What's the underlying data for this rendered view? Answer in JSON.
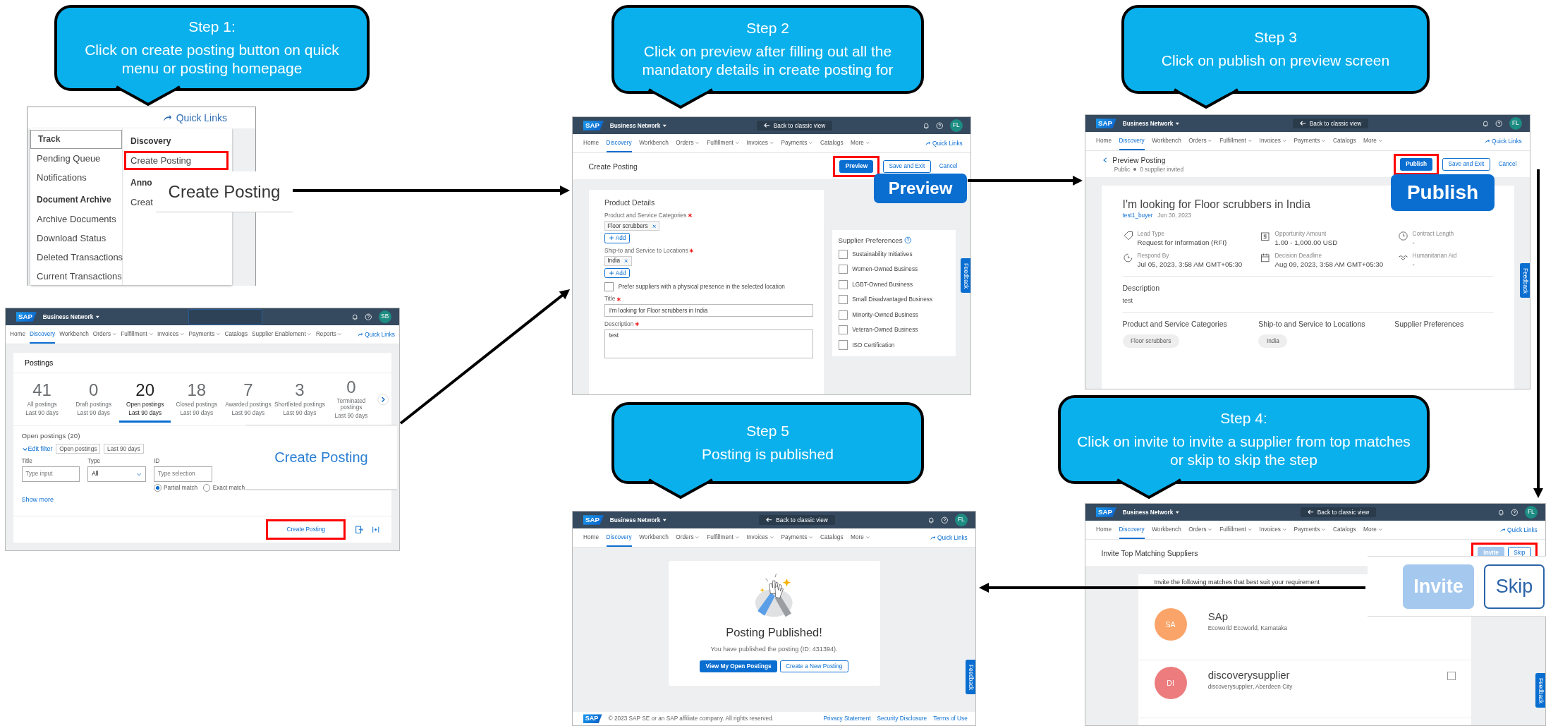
{
  "callouts": [
    {
      "title": "Step 1:",
      "text": "Click on create posting button on quick menu or posting homepage"
    },
    {
      "title": "Step 2",
      "text": "Click on preview  after filling out all the mandatory details in create posting for"
    },
    {
      "title": "Step 3",
      "text": "Click on publish on preview screen"
    },
    {
      "title": "Step 5",
      "text": "Posting is published"
    },
    {
      "title": "Step 4:",
      "text": "Click on invite to invite a supplier from top matches or skip to skip the step"
    }
  ],
  "menu": {
    "quick_links": "Quick Links",
    "zoom": "Create Posting",
    "columns": [
      {
        "items": [
          {
            "kind": "tab",
            "label": "Track",
            "highlighted": false
          },
          {
            "kind": "link",
            "label": "Pending Queue",
            "highlighted": false
          },
          {
            "kind": "link",
            "label": "Notifications",
            "highlighted": false
          },
          {
            "kind": "heading",
            "label": "Document Archive",
            "highlighted": false
          },
          {
            "kind": "link",
            "label": "Archive Documents",
            "highlighted": false
          },
          {
            "kind": "link",
            "label": "Download Status",
            "highlighted": false
          },
          {
            "kind": "link",
            "label": "Deleted Transactions",
            "highlighted": false
          },
          {
            "kind": "link",
            "label": "Current Transactions",
            "highlighted": false
          }
        ]
      },
      {
        "items": [
          {
            "kind": "heading",
            "label": "Discovery",
            "highlighted": false
          },
          {
            "kind": "link",
            "label": "Create Posting",
            "highlighted": true
          },
          {
            "kind": "heading",
            "label": "Anno",
            "highlighted": false
          },
          {
            "kind": "link",
            "label": "Creat",
            "highlighted": false
          }
        ]
      }
    ]
  },
  "screens": [
    {
      "kind": "postings",
      "header": {
        "logo": "SAP",
        "product": "Business Network",
        "avatar": "SB",
        "quick_links": "Quick Links",
        "nav": [
          {
            "label": "Home",
            "selected": false,
            "menu": false
          },
          {
            "label": "Discovery",
            "selected": true,
            "menu": false
          },
          {
            "label": "Workbench",
            "selected": false,
            "menu": false
          },
          {
            "label": "Orders",
            "selected": false,
            "menu": true
          },
          {
            "label": "Fulfillment",
            "selected": false,
            "menu": true
          },
          {
            "label": "Invoices",
            "selected": false,
            "menu": true
          },
          {
            "label": "Payments",
            "selected": false,
            "menu": true
          },
          {
            "label": "Catalogs",
            "selected": false,
            "menu": false
          },
          {
            "label": "Supplier Enablement",
            "selected": false,
            "menu": true
          },
          {
            "label": "Reports",
            "selected": false,
            "menu": true
          }
        ]
      },
      "title": "Postings",
      "tiles": [
        {
          "count": "41",
          "label": "All postings",
          "period": "Last 90 days",
          "selected": false
        },
        {
          "count": "0",
          "label": "Draft postings",
          "period": "Last 90 days",
          "selected": false
        },
        {
          "count": "20",
          "label": "Open postings",
          "period": "Last 90 days",
          "selected": true
        },
        {
          "count": "18",
          "label": "Closed postings",
          "period": "Last 90 days",
          "selected": false
        },
        {
          "count": "7",
          "label": "Awarded postings",
          "period": "Last 90 days",
          "selected": false
        },
        {
          "count": "3",
          "label": "Shortlisted postings",
          "period": "Last 90 days",
          "selected": false
        },
        {
          "count": "0",
          "label": "Terminated postings",
          "period": "Last 90 days",
          "selected": false
        }
      ],
      "list_title": "Open postings (20)",
      "edit_filter": "Edit filter",
      "chips": [
        "Open postings",
        "Last 90 days"
      ],
      "filters": [
        {
          "label": "Title",
          "placeholder": "Type input",
          "kind": "input"
        },
        {
          "label": "Type",
          "value": "All",
          "kind": "select"
        },
        {
          "label": "ID",
          "placeholder": "Type selection",
          "kind": "input"
        }
      ],
      "radios": [
        {
          "label": "Partial match",
          "selected": true
        },
        {
          "label": "Exact match",
          "selected": false
        }
      ],
      "show_more": "Show more",
      "action": {
        "label": "Create Posting",
        "highlighted": true
      },
      "zoom": "Create Posting"
    },
    {
      "kind": "create",
      "header": {
        "logo": "SAP",
        "product": "Business Network",
        "back": "Back to classic view",
        "avatar": "FL",
        "quick_links": "Quick Links",
        "nav": [
          {
            "label": "Home",
            "selected": false,
            "menu": false
          },
          {
            "label": "Discovery",
            "selected": true,
            "menu": false
          },
          {
            "label": "Workbench",
            "selected": false,
            "menu": false
          },
          {
            "label": "Orders",
            "selected": false,
            "menu": true
          },
          {
            "label": "Fulfillment",
            "selected": false,
            "menu": true
          },
          {
            "label": "Invoices",
            "selected": false,
            "menu": true
          },
          {
            "label": "Payments",
            "selected": false,
            "menu": true
          },
          {
            "label": "Catalogs",
            "selected": false,
            "menu": false
          },
          {
            "label": "More",
            "selected": false,
            "menu": true
          }
        ]
      },
      "page_title": "Create Posting",
      "actions": [
        {
          "label": "Preview",
          "kind": "primary",
          "highlighted": true,
          "disabled": false
        },
        {
          "label": "Save and Exit",
          "kind": "secondary",
          "highlighted": false,
          "disabled": false
        },
        {
          "label": "Cancel",
          "kind": "link",
          "highlighted": false,
          "disabled": false
        }
      ],
      "section": "Product Details",
      "fields": [
        {
          "kind": "tokens",
          "label": "Product and Service Categories",
          "required": true,
          "tokens": [
            "Floor scrubbers"
          ],
          "add": "Add"
        },
        {
          "kind": "tokens",
          "label": "Ship-to and Service to Locations",
          "required": true,
          "tokens": [
            "India"
          ],
          "add": "Add"
        },
        {
          "kind": "checkbox",
          "label": "Prefer suppliers with a physical presence in the selected location",
          "checked": false
        },
        {
          "kind": "input",
          "label": "Title",
          "required": true,
          "value": "I'm looking for Floor scrubbers in India"
        },
        {
          "kind": "textarea",
          "label": "Description",
          "required": true,
          "value": "test"
        }
      ],
      "preferences_title": "Supplier Preferences",
      "preferences": [
        {
          "label": "Sustainability Initiatives",
          "checked": false
        },
        {
          "label": "Women-Owned Business",
          "checked": false
        },
        {
          "label": "LGBT-Owned Business",
          "checked": false
        },
        {
          "label": "Small Disadvantaged Business",
          "checked": false
        },
        {
          "label": "Minority-Owned Business",
          "checked": false
        },
        {
          "label": "Veteran-Owned Business",
          "checked": false
        },
        {
          "label": "ISO Certification",
          "checked": false
        }
      ],
      "feedback": "Feedback",
      "zoom": [
        "Preview"
      ]
    },
    {
      "kind": "preview",
      "header": {
        "logo": "SAP",
        "product": "Business Network",
        "back": "Back to classic view",
        "avatar": "FL",
        "quick_links": "Quick Links",
        "nav": [
          {
            "label": "Home",
            "selected": false,
            "menu": false
          },
          {
            "label": "Discovery",
            "selected": true,
            "menu": false
          },
          {
            "label": "Workbench",
            "selected": false,
            "menu": false
          },
          {
            "label": "Orders",
            "selected": false,
            "menu": true
          },
          {
            "label": "Fulfillment",
            "selected": false,
            "menu": true
          },
          {
            "label": "Invoices",
            "selected": false,
            "menu": true
          },
          {
            "label": "Payments",
            "selected": false,
            "menu": true
          },
          {
            "label": "Catalogs",
            "selected": false,
            "menu": false
          },
          {
            "label": "More",
            "selected": false,
            "menu": true
          }
        ]
      },
      "page_title": "Preview Posting",
      "status": [
        "Public",
        "0 supplier invited"
      ],
      "actions": [
        {
          "label": "Publish",
          "kind": "primary",
          "highlighted": true,
          "disabled": false
        },
        {
          "label": "Save and Exit",
          "kind": "secondary",
          "highlighted": false,
          "disabled": false
        },
        {
          "label": "Cancel",
          "kind": "link",
          "highlighted": false,
          "disabled": false
        }
      ],
      "posting_title": "I'm looking for Floor scrubbers in India",
      "author": "test1_buyer",
      "date": "Jun 30, 2023",
      "facts": [
        {
          "label": "Lead Type",
          "value": "Request for Information (RFI)"
        },
        {
          "label": "Opportunity Amount",
          "value": "1.00 - 1,000.00 USD"
        },
        {
          "label": "Contract Length",
          "value": "-"
        },
        {
          "label": "Respond By",
          "value": "Jul 05, 2023, 3:58 AM GMT+05:30"
        },
        {
          "label": "Decision Deadline",
          "value": "Aug 09, 2023, 3:58 AM GMT+05:30"
        },
        {
          "label": "Humanitarian Aid",
          "value": "-"
        }
      ],
      "description_title": "Description",
      "description": "test",
      "columns": [
        {
          "title": "Product and Service Categories",
          "chips": [
            "Floor scrubbers"
          ]
        },
        {
          "title": "Ship-to and Service to Locations",
          "chips": [
            "India"
          ]
        },
        {
          "title": "Supplier Preferences"
        }
      ],
      "feedback": "Feedback",
      "zoom": [
        "Publish"
      ]
    },
    {
      "kind": "published",
      "header": {
        "logo": "SAP",
        "product": "Business Network",
        "back": "Back to classic view",
        "avatar": "FL",
        "quick_links": "Quick Links",
        "nav": [
          {
            "label": "Home",
            "selected": false,
            "menu": false
          },
          {
            "label": "Discovery",
            "selected": true,
            "menu": false
          },
          {
            "label": "Workbench",
            "selected": false,
            "menu": false
          },
          {
            "label": "Orders",
            "selected": false,
            "menu": true
          },
          {
            "label": "Fulfillment",
            "selected": false,
            "menu": true
          },
          {
            "label": "Invoices",
            "selected": false,
            "menu": true
          },
          {
            "label": "Payments",
            "selected": false,
            "menu": true
          },
          {
            "label": "Catalogs",
            "selected": false,
            "menu": false
          },
          {
            "label": "More",
            "selected": false,
            "menu": true
          }
        ]
      },
      "heading": "Posting Published!",
      "message": "You have published the posting (ID: 431394).",
      "actions": [
        {
          "label": "View My Open Postings",
          "kind": "primary",
          "disabled": false
        },
        {
          "label": "Create a New Posting",
          "kind": "secondary",
          "disabled": false
        }
      ],
      "footer": {
        "logo": "SAP",
        "copyright": "© 2023 SAP SE or an SAP affiliate company. All rights reserved.",
        "links": [
          "Privacy Statement",
          "Security Disclosure",
          "Terms of Use"
        ]
      },
      "feedback": "Feedback"
    },
    {
      "kind": "invite",
      "header": {
        "logo": "SAP",
        "product": "Business Network",
        "back": "Back to classic view",
        "avatar": "FL",
        "quick_links": "Quick Links",
        "nav": [
          {
            "label": "Home",
            "selected": false,
            "menu": false
          },
          {
            "label": "Discovery",
            "selected": true,
            "menu": false
          },
          {
            "label": "Workbench",
            "selected": false,
            "menu": false
          },
          {
            "label": "Orders",
            "selected": false,
            "menu": true
          },
          {
            "label": "Fulfillment",
            "selected": false,
            "menu": true
          },
          {
            "label": "Invoices",
            "selected": false,
            "menu": true
          },
          {
            "label": "Payments",
            "selected": false,
            "menu": true
          },
          {
            "label": "Catalogs",
            "selected": false,
            "menu": false
          },
          {
            "label": "More",
            "selected": false,
            "menu": true
          }
        ]
      },
      "page_title": "Invite Top Matching Suppliers",
      "actions": [
        {
          "label": "Invite",
          "kind": "primary",
          "highlighted": true,
          "disabled": true
        },
        {
          "label": "Skip",
          "kind": "secondary",
          "highlighted": true,
          "disabled": false
        }
      ],
      "card_title": "Invite the following matches that best suit your requirement",
      "suppliers": [
        {
          "initials": "SA",
          "name": "SAp",
          "location": "Ecoworld Ecoworld, Karnataka",
          "color": "#fba469"
        },
        {
          "initials": "DI",
          "name": "discoverysupplier",
          "location": "discoverysupplier, Aberdeen City",
          "color": "#ec7c7d",
          "checked": false
        }
      ],
      "feedback": "Feedback",
      "zoom": [
        "Invite",
        "Skip"
      ]
    }
  ]
}
